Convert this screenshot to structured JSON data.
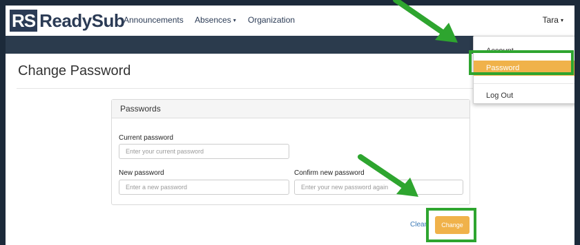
{
  "app": {
    "logo_mark": "RS",
    "logo_name": "ReadySub"
  },
  "nav": {
    "items": [
      {
        "label": "Announcements"
      },
      {
        "label": "Absences"
      },
      {
        "label": "Organization"
      }
    ],
    "user": "Tara"
  },
  "page": {
    "title": "Change Password"
  },
  "panel": {
    "heading": "Passwords",
    "current": {
      "label": "Current password",
      "placeholder": "Enter your current password"
    },
    "new": {
      "label": "New password",
      "placeholder": "Enter a new password"
    },
    "confirm": {
      "label": "Confirm new password",
      "placeholder": "Enter your new password again"
    }
  },
  "actions": {
    "clear": "Clear",
    "change": "Change"
  },
  "user_menu": {
    "items": [
      {
        "label": "Account"
      },
      {
        "label": "Password"
      },
      {
        "label": "Log Out"
      }
    ]
  },
  "colors": {
    "navy": "#2b3b55",
    "accent": "#f0b24a",
    "annotation": "#2ea52f"
  }
}
